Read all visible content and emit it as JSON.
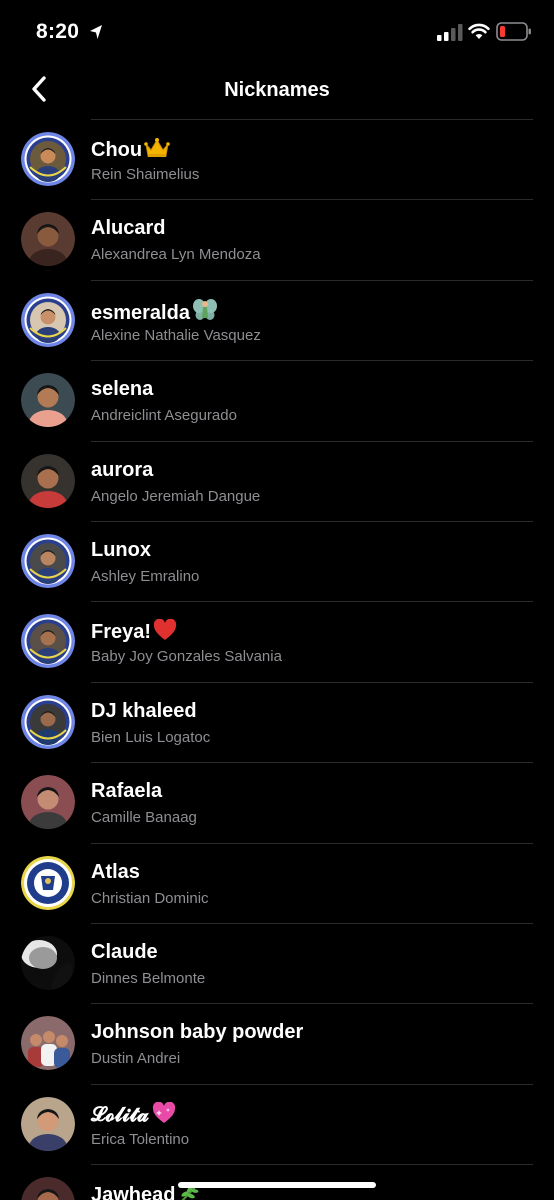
{
  "status_bar": {
    "time": "8:20",
    "battery_color": "#ff3b30"
  },
  "nav": {
    "title": "Nicknames"
  },
  "members": [
    {
      "nickname": "Chou",
      "name": "Rein Shaimelius",
      "emoji": "crown-icon",
      "avatar": "ring",
      "bg": "#6b5a3c",
      "skin": "#c98a5a",
      "shirt": "#2a3f7a"
    },
    {
      "nickname": "Alucard",
      "name": "Alexandrea Lyn Mendoza",
      "emoji": "",
      "avatar": "photo",
      "bg": "#5a3b32",
      "skin": "#8a5a3e",
      "shirt": "#3a2420"
    },
    {
      "nickname": "esmeralda",
      "name": "Alexine Nathalie Vasquez",
      "emoji": "fairy-icon",
      "avatar": "ring",
      "bg": "#d8c7b0",
      "skin": "#c9916a",
      "shirt": "#2a3f7a"
    },
    {
      "nickname": "selena",
      "name": "Andreiclint Asegurado",
      "emoji": "",
      "avatar": "photo",
      "bg": "#3c4a52",
      "skin": "#b27a55",
      "shirt": "#e9a08f"
    },
    {
      "nickname": "aurora",
      "name": "Angelo Jeremiah Dangue",
      "emoji": "",
      "avatar": "photo",
      "bg": "#36332f",
      "skin": "#a8704e",
      "shirt": "#c73b3b"
    },
    {
      "nickname": "Lunox",
      "name": "Ashley Emralino",
      "emoji": "",
      "avatar": "ring",
      "bg": "#4a4a4a",
      "skin": "#b98460",
      "shirt": "#2a3f7a"
    },
    {
      "nickname": "Freya!",
      "name": "Baby Joy Gonzales Salvania",
      "emoji": "heart-icon",
      "avatar": "ring",
      "bg": "#5b5047",
      "skin": "#a57250",
      "shirt": "#2a3f7a"
    },
    {
      "nickname": "DJ khaleed",
      "name": "Bien Luis Logatoc",
      "emoji": "",
      "avatar": "ring",
      "bg": "#3a3a3a",
      "skin": "#9a6a4c",
      "shirt": "#1f3b6e"
    },
    {
      "nickname": "Rafaela",
      "name": "Camille Banaag",
      "emoji": "",
      "avatar": "photo",
      "bg": "#8a4e52",
      "skin": "#c58c74",
      "shirt": "#3b3b3b"
    },
    {
      "nickname": "Atlas",
      "name": "Christian Dominic",
      "emoji": "",
      "avatar": "badge",
      "bg": "#1f3d8a",
      "skin": "#e0c25a",
      "shirt": "#1f3d8a"
    },
    {
      "nickname": "Claude",
      "name": "Dinnes Belmonte",
      "emoji": "",
      "avatar": "dark",
      "bg": "#2b2b2b",
      "skin": "#d9d9d9",
      "shirt": "#111111"
    },
    {
      "nickname": "Johnson baby powder",
      "name": "Dustin Andrei",
      "emoji": "",
      "avatar": "group",
      "bg": "#8a6a6a",
      "skin": "#c58a6a",
      "shirt": "#a83a3a"
    },
    {
      "nickname": "𝓛𝓸𝓵𝓲𝓽𝓪",
      "name": "Erica Tolentino",
      "emoji": "sparkle-heart-icon",
      "avatar": "photo",
      "bg": "#b8a58c",
      "skin": "#d29a78",
      "shirt": "#3a3f6a"
    },
    {
      "nickname": "Jawhead",
      "name": "",
      "emoji": "herb-icon",
      "avatar": "photo",
      "bg": "#4a2a2a",
      "skin": "#a86a4c",
      "shirt": "#6a1f1f"
    }
  ]
}
